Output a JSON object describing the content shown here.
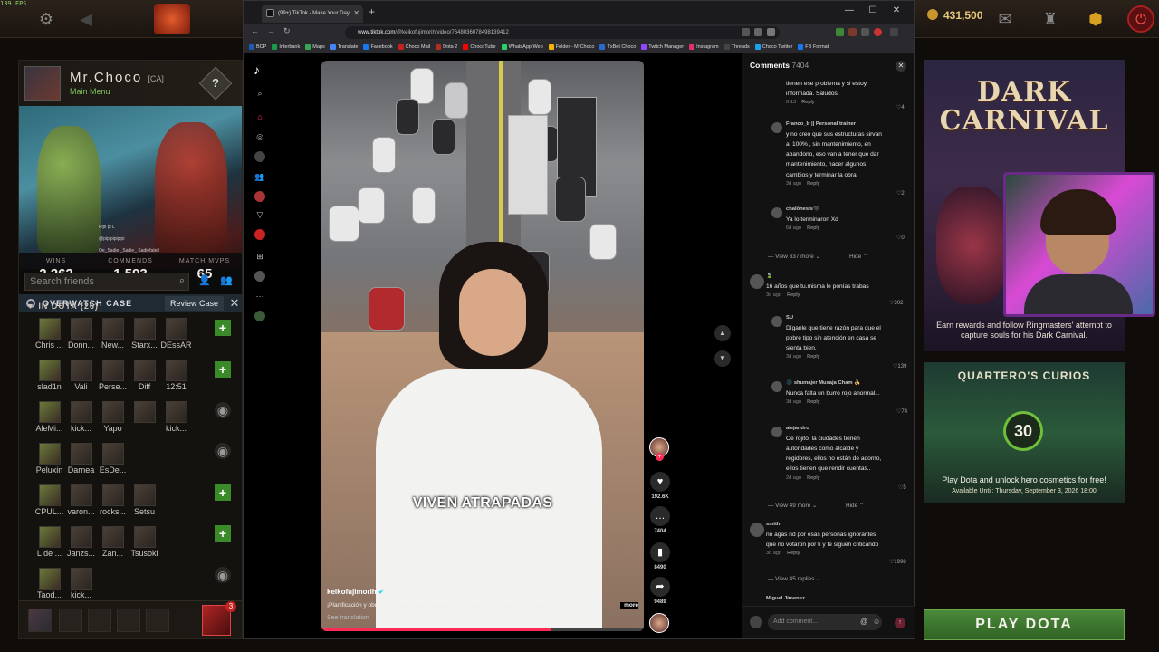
{
  "hud": {
    "fps": "139 FPS",
    "gold": "431,500"
  },
  "profile": {
    "name": "Mr.Choco",
    "tag": "[CA]",
    "subtitle": "Main Menu",
    "help": "?",
    "voice_lines": [
      "Pipi pi L",
      "@pipipipipipi",
      "Oe_Sadie _Sadie_ Sadiefatell"
    ],
    "stats": [
      {
        "label": "WINS",
        "value": "2,262"
      },
      {
        "label": "COMMENDS",
        "value": "1,593"
      },
      {
        "label": "MATCH MVPS",
        "value": "65"
      }
    ]
  },
  "overwatch": {
    "title": "OVERWATCH CASE",
    "review_label": "Review Case",
    "close": "✕"
  },
  "friends": {
    "search_placeholder": "Search friends",
    "section_label": "IN DOTA (26)",
    "rows": [
      {
        "names": [
          "Chris ...",
          "Donn...",
          "New...",
          "Starx...",
          "DEssAR"
        ],
        "status": "plus"
      },
      {
        "names": [
          "slad1n",
          "Vali",
          "Perse...",
          "Diff",
          "12:51"
        ],
        "status": "plus"
      },
      {
        "names": [
          "AleMi...",
          "kick...",
          "Yapo",
          "",
          "kick..."
        ],
        "status": "eye"
      },
      {
        "names": [
          "Peluxin",
          "Darnea",
          "EsDe...",
          "",
          ""
        ],
        "status": "eye"
      },
      {
        "names": [
          "CPUL...",
          "varon...",
          "rocks...",
          "Setsu",
          ""
        ],
        "status": "plus"
      },
      {
        "names": [
          "L de ...",
          "Janzs...",
          "Zan...",
          "Tsusoki",
          ""
        ],
        "status": "plus"
      },
      {
        "names": [
          "Taod...",
          "kick...",
          "",
          "",
          ""
        ],
        "status": "eye"
      }
    ],
    "party_count": "3"
  },
  "browser": {
    "tab_title": "(99+) TikTok - Make Your Day",
    "url_host": "www.tiktok.com",
    "url_path": "/@keikofujimorih/video/7648036078498139412",
    "bookmarks": [
      {
        "label": "BCP",
        "color": "#1e5ab4"
      },
      {
        "label": "Interbank",
        "color": "#1a9c4a"
      },
      {
        "label": "Maps",
        "color": "#34a853"
      },
      {
        "label": "Translate",
        "color": "#4285f4"
      },
      {
        "label": "Facebook",
        "color": "#1877f2"
      },
      {
        "label": "Choco Mail",
        "color": "#c5221f"
      },
      {
        "label": "Dota 2",
        "color": "#b32d1e"
      },
      {
        "label": "ChocoTube",
        "color": "#ff0000"
      },
      {
        "label": "WhatsApp Web",
        "color": "#25d366"
      },
      {
        "label": "Folder - MrChoco",
        "color": "#f4b400"
      },
      {
        "label": "TxBet Choco",
        "color": "#2a6ad0"
      },
      {
        "label": "Twitch Manager",
        "color": "#9146ff"
      },
      {
        "label": "Instagram",
        "color": "#e1306c"
      },
      {
        "label": "Threads",
        "color": "#444444"
      },
      {
        "label": "Choco Twitter",
        "color": "#1da1f2"
      },
      {
        "label": "FB Format",
        "color": "#1877f2"
      }
    ]
  },
  "tiktok": {
    "caption": "VIVEN ATRAPADAS",
    "author": "keikofujimorih",
    "description": "¡Planificación y obras terminadas para Arequipa! Destrabaremos la autopista Arequipa - La Joya...",
    "more": "more",
    "translate": "See translation",
    "progress": 0.71,
    "actions": {
      "likes": "192.6K",
      "comments": "7404",
      "saves": "8490",
      "shares": "9489"
    }
  },
  "comments": {
    "title": "Comments",
    "count": "7404",
    "close": "✕",
    "items": [
      {
        "user": "",
        "text": [
          "tienen ese problema y si estoy",
          "informada. Saludos."
        ],
        "date": "6-13",
        "likes": "4"
      },
      {
        "user": "Franco_Ir || Personal trainer",
        "text": [
          "y no creo que sus estructuras sirvan",
          "al 100% , sin mantenimiento, en",
          "abandono, eso van a tener que dar",
          "mantenimiento, hacer algunos",
          "cambios y terminar la obra"
        ],
        "date": "3d ago",
        "likes": "2"
      },
      {
        "user": "chalónesis🖤",
        "text": [
          "Ya lo terminaron Xd"
        ],
        "date": "6d ago",
        "likes": "0"
      },
      {
        "user": "🍃",
        "text": [
          "16 años que tu.misma le ponías trabas"
        ],
        "date": "3d ago",
        "likes": "302"
      },
      {
        "user": "SU",
        "text": [
          "Díganle que tiene razón para que el",
          "pobre tipo sin atención en casa se",
          "sienta bien."
        ],
        "date": "3d ago",
        "likes": "139"
      },
      {
        "user": "🌑 shumajer Musaja Cham 🍌",
        "text": [
          "Nunca falta un burro rojo anormal..."
        ],
        "date": "3d ago",
        "likes": "74"
      },
      {
        "user": "alejandro",
        "text": [
          "Oe rojito, la ciudades tienen",
          "autoridades como alcalde y",
          "regidores, ellos no están de adorno,",
          "ellos tienen que rendir cuentas.."
        ],
        "date": "2d ago",
        "likes": "5"
      },
      {
        "user": "smith",
        "text": [
          "no agas nd por esas personas ignorantes",
          "que no votaron por ti y te siguen criticando"
        ],
        "date": "3d ago",
        "likes": "1998"
      },
      {
        "user": "Miguel Jimenez",
        "text": [],
        "date": "",
        "likes": ""
      }
    ],
    "reply_label": "Reply",
    "view_more_1": "View 337 more",
    "view_more_2": "View 49 more",
    "view_more_3": "View 45 replies",
    "hide": "Hide",
    "add_placeholder": "Add comment..."
  },
  "dota_panels": {
    "dark_carnival_title_1": "DARK",
    "dark_carnival_title_2": "CARNIVAL",
    "dark_carnival_caption": "Earn rewards and follow Ringmasters' attempt to capture souls for his Dark Carnival.",
    "curios_title": "QUARTERO'S CURIOS",
    "curios_badge": "30",
    "curios_caption": "Play Dota and unlock hero cosmetics for free!",
    "curios_avail": "Available Until:  Thursday, September 3, 2026 18:00",
    "play_button": "PLAY DOTA"
  }
}
